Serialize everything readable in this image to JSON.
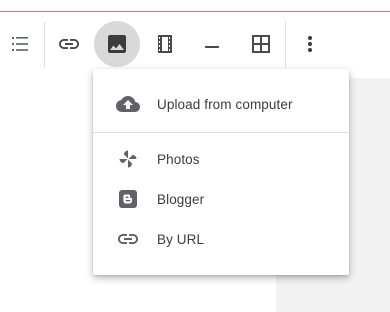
{
  "toolbar": {
    "buttons": [
      {
        "name": "bulleted-list-button",
        "icon": "format-list-bulleted-icon",
        "active": false
      },
      {
        "name": "insert-link-button",
        "icon": "link-icon",
        "active": false
      },
      {
        "name": "insert-image-button",
        "icon": "image-icon",
        "active": true
      },
      {
        "name": "insert-video-button",
        "icon": "movie-icon",
        "active": false
      },
      {
        "name": "insert-separator-button",
        "icon": "horizontal-rule-icon",
        "active": false
      },
      {
        "name": "insert-table-button",
        "icon": "table-grid-icon",
        "active": false
      },
      {
        "name": "more-options-button",
        "icon": "more-vert-icon",
        "active": false
      }
    ]
  },
  "image_menu": {
    "items": [
      {
        "label": "Upload from computer",
        "icon": "cloud-upload-icon"
      },
      {
        "label": "Photos",
        "icon": "google-photos-icon"
      },
      {
        "label": "Blogger",
        "icon": "blogger-icon"
      },
      {
        "label": "By URL",
        "icon": "link-icon"
      }
    ]
  },
  "colors": {
    "icon": "#5f6368",
    "active_button_bg": "#d9d9d9",
    "top_rule": "#e57373",
    "menu_text": "#3c3c3c"
  }
}
